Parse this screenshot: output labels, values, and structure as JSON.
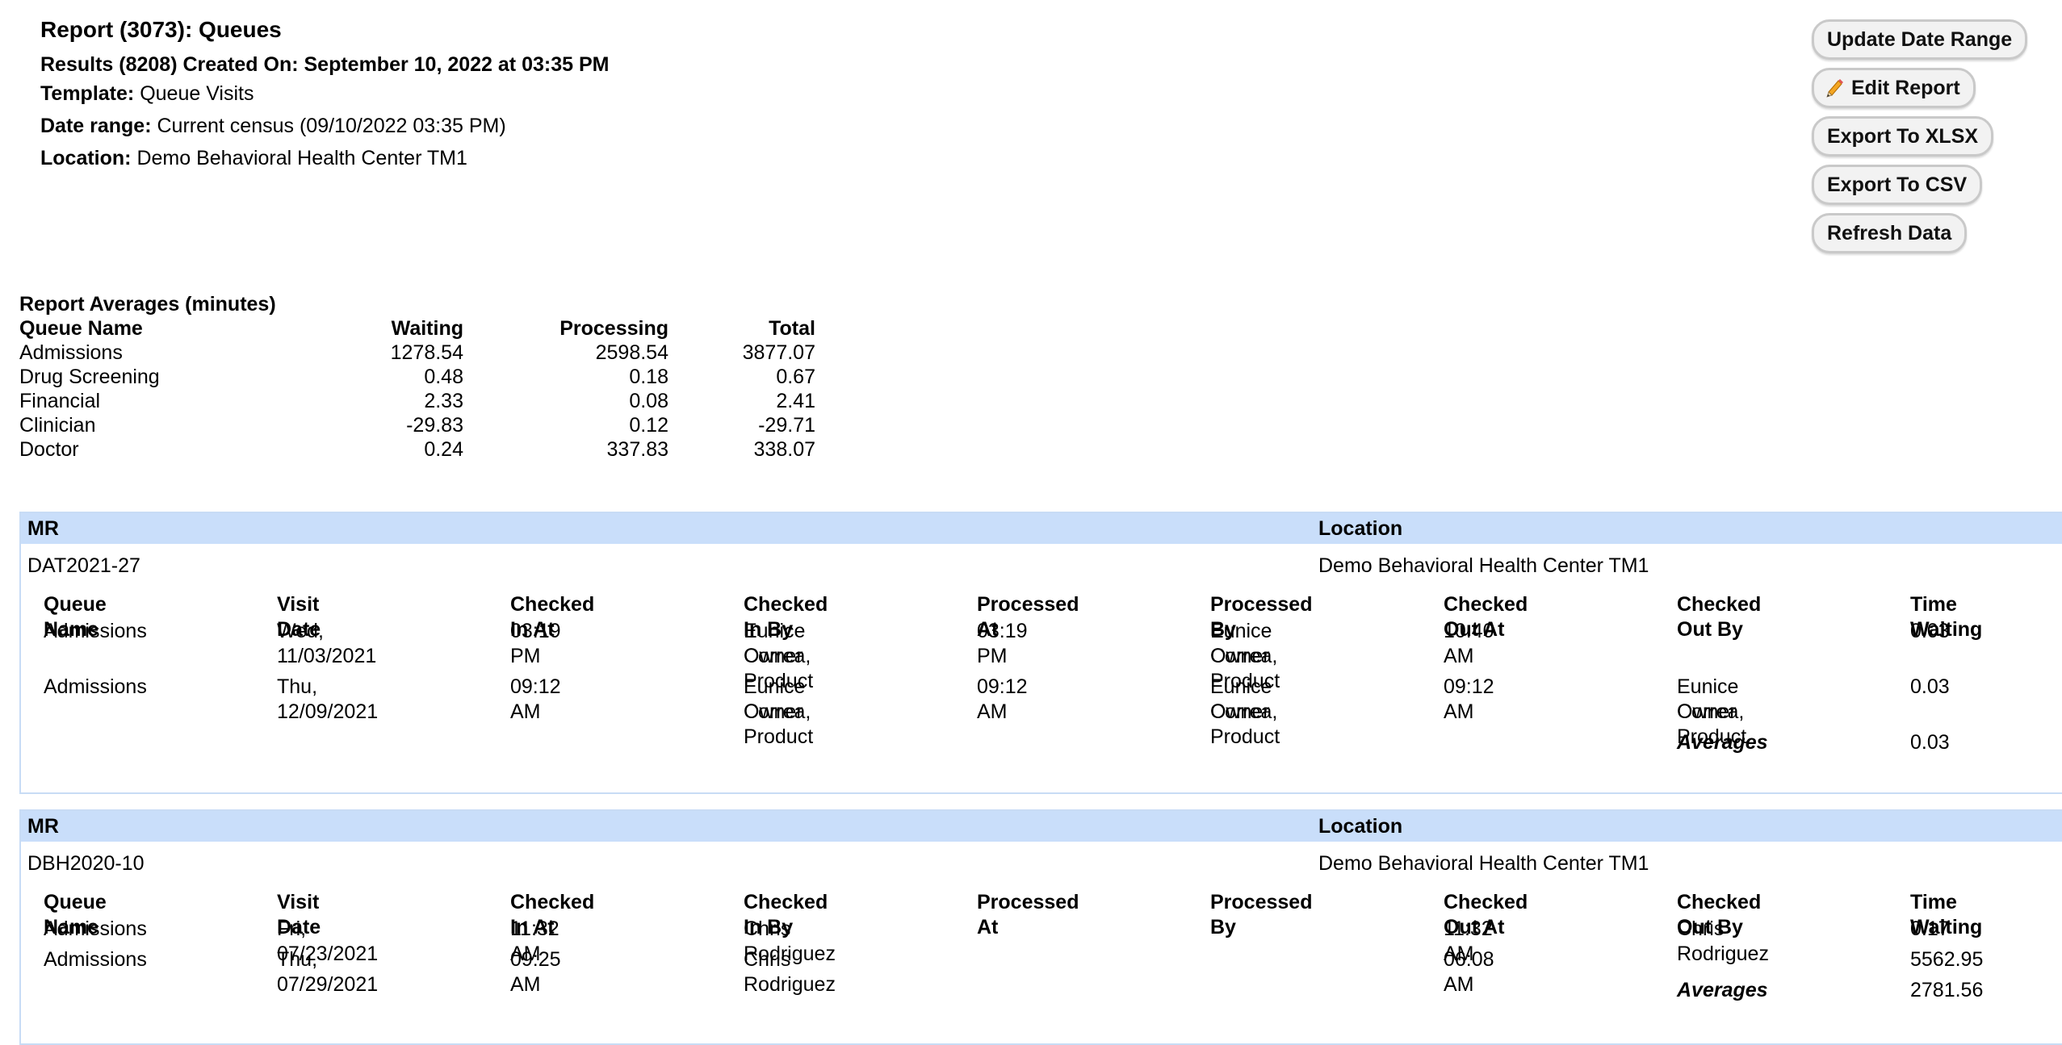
{
  "header": {
    "title": "Report (3073): Queues",
    "results": "Results (8208) Created On: September 10, 2022 at 03:35 PM",
    "template_label": "Template:",
    "template_value": "Queue Visits",
    "date_range_label": "Date range:",
    "date_range_value": "Current census (09/10/2022 03:35 PM)",
    "location_label": "Location:",
    "location_value": "Demo Behavioral Health Center TM1"
  },
  "buttons": {
    "update_date_range": "Update Date Range",
    "edit_report": "Edit Report",
    "export_xlsx": "Export To XLSX",
    "export_csv": "Export To CSV",
    "refresh_data": "Refresh Data",
    "edit_icon": "pencil-icon"
  },
  "averages": {
    "caption": "Report Averages (minutes)",
    "columns": [
      "Queue Name",
      "Waiting",
      "Processing",
      "Total"
    ],
    "rows": [
      [
        "Admissions",
        "1278.54",
        "2598.54",
        "3877.07"
      ],
      [
        "Drug Screening",
        "0.48",
        "0.18",
        "0.67"
      ],
      [
        "Financial",
        "2.33",
        "0.08",
        "2.41"
      ],
      [
        "Clinician",
        "-29.83",
        "0.12",
        "-29.71"
      ],
      [
        "Doctor",
        "0.24",
        "337.83",
        "338.07"
      ]
    ]
  },
  "group_header": {
    "mr": "MR",
    "location": "Location"
  },
  "visit_columns": [
    "Queue Name",
    "Visit Date",
    "Checked In At",
    "Checked In By",
    "Processed At",
    "Processed By",
    "Checked Out At",
    "Checked Out By",
    "Time Waiting"
  ],
  "averages_label": "Averages",
  "groups": [
    {
      "mr": "DAT2021-27",
      "location": "Demo Behavioral Health Center TM1",
      "visits": [
        {
          "queue": "Admissions",
          "visit_date": "Wed, 11/03/2021",
          "checked_in_at": "03:19 PM",
          "checked_in_by_1": "Eunice Correa, Product",
          "checked_in_by_2": "Owner",
          "processed_at": "03:19 PM",
          "processed_by_1": "Eunice Correa, Product",
          "processed_by_2": "Owner",
          "checked_out_at": "10:40 AM",
          "checked_out_by_1": "",
          "checked_out_by_2": "",
          "time_waiting": "0.03"
        },
        {
          "queue": "Admissions",
          "visit_date": "Thu, 12/09/2021",
          "checked_in_at": "09:12 AM",
          "checked_in_by_1": "Eunice Correa, Product",
          "checked_in_by_2": "Owner",
          "processed_at": "09:12 AM",
          "processed_by_1": "Eunice Correa, Product",
          "processed_by_2": "Owner",
          "checked_out_at": "09:12 AM",
          "checked_out_by_1": "Eunice Correa, Product",
          "checked_out_by_2": "Owner",
          "time_waiting": "0.03"
        }
      ],
      "average": "0.03"
    },
    {
      "mr": "DBH2020-10",
      "location": "Demo Behavioral Health Center TM1",
      "visits": [
        {
          "queue": "Admissions",
          "visit_date": "Fri, 07/23/2021",
          "checked_in_at": "11:32 AM",
          "checked_in_by_1": "Chris Rodriguez",
          "checked_in_by_2": "",
          "processed_at": "",
          "processed_by_1": "",
          "processed_by_2": "",
          "checked_out_at": "11:32 AM",
          "checked_out_by_1": "Chris Rodriguez",
          "checked_out_by_2": "",
          "time_waiting": "0.17"
        },
        {
          "queue": "Admissions",
          "visit_date": "Thu, 07/29/2021",
          "checked_in_at": "09:25 AM",
          "checked_in_by_1": "Chris Rodriguez",
          "checked_in_by_2": "",
          "processed_at": "",
          "processed_by_1": "",
          "processed_by_2": "",
          "checked_out_at": "06:08 AM",
          "checked_out_by_1": "",
          "checked_out_by_2": "",
          "time_waiting": "5562.95"
        }
      ],
      "average": "2781.56"
    }
  ]
}
